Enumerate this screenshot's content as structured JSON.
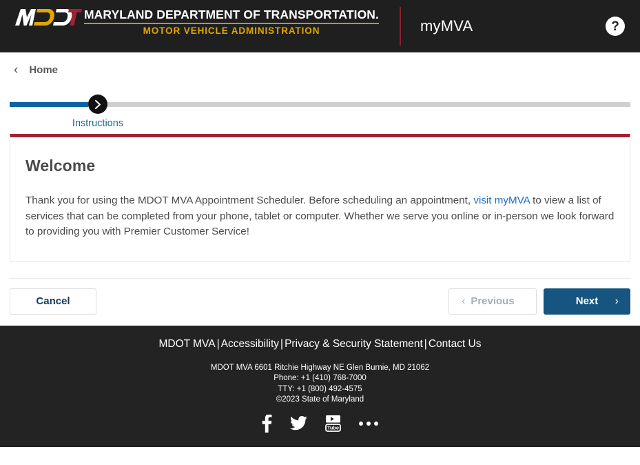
{
  "header": {
    "logo": {
      "mark_alt": "MDOT",
      "department_line": "MARYLAND DEPARTMENT OF TRANSPORTATION.",
      "administration_line": "MOTOR VEHICLE ADMINISTRATION"
    },
    "app_title": "myMVA",
    "help_label": "?",
    "background_color": "#1f1f1f",
    "accent_gold": "#e1a700",
    "accent_red": "#a32035"
  },
  "breadcrumb": {
    "back_icon": "‹",
    "label": "Home"
  },
  "progress": {
    "steps": [
      {
        "label": "Instructions",
        "state": "current",
        "icon": "chevron-right"
      }
    ],
    "fill_color": "#0a64a4",
    "track_color": "#cfcfcf",
    "node_color": "#111111"
  },
  "card": {
    "title": "Welcome",
    "body_part1": "Thank you for using the MDOT MVA Appointment Scheduler. Before scheduling an appointment, ",
    "link_text": "visit myMVA",
    "body_part2": " to view a list of services that can be completed from your phone, tablet or computer. Whether we serve you online or in-person we look forward to providing you with Premier Customer Service!",
    "top_border_color": "#a32035"
  },
  "actions": {
    "cancel_label": "Cancel",
    "previous_label": "Previous",
    "previous_icon": "‹",
    "next_label": "Next",
    "next_icon": "›",
    "next_color": "#15557f"
  },
  "footer": {
    "links": [
      {
        "label": "MDOT MVA"
      },
      {
        "label": "Accessibility"
      },
      {
        "label": "Privacy & Security Statement"
      },
      {
        "label": "Contact Us"
      }
    ],
    "separator": "|",
    "address": "MDOT MVA 6601 Ritchie Highway NE Glen Burnie, MD 21062",
    "phone": "Phone: +1 (410) 768-7000",
    "tty": "TTY: +1 (800) 492-4575",
    "copyright": "©2023 State of Maryland",
    "social": [
      {
        "name": "facebook-icon"
      },
      {
        "name": "twitter-icon"
      },
      {
        "name": "youtube-icon"
      },
      {
        "name": "more-icon"
      }
    ],
    "background_color": "#232323"
  }
}
